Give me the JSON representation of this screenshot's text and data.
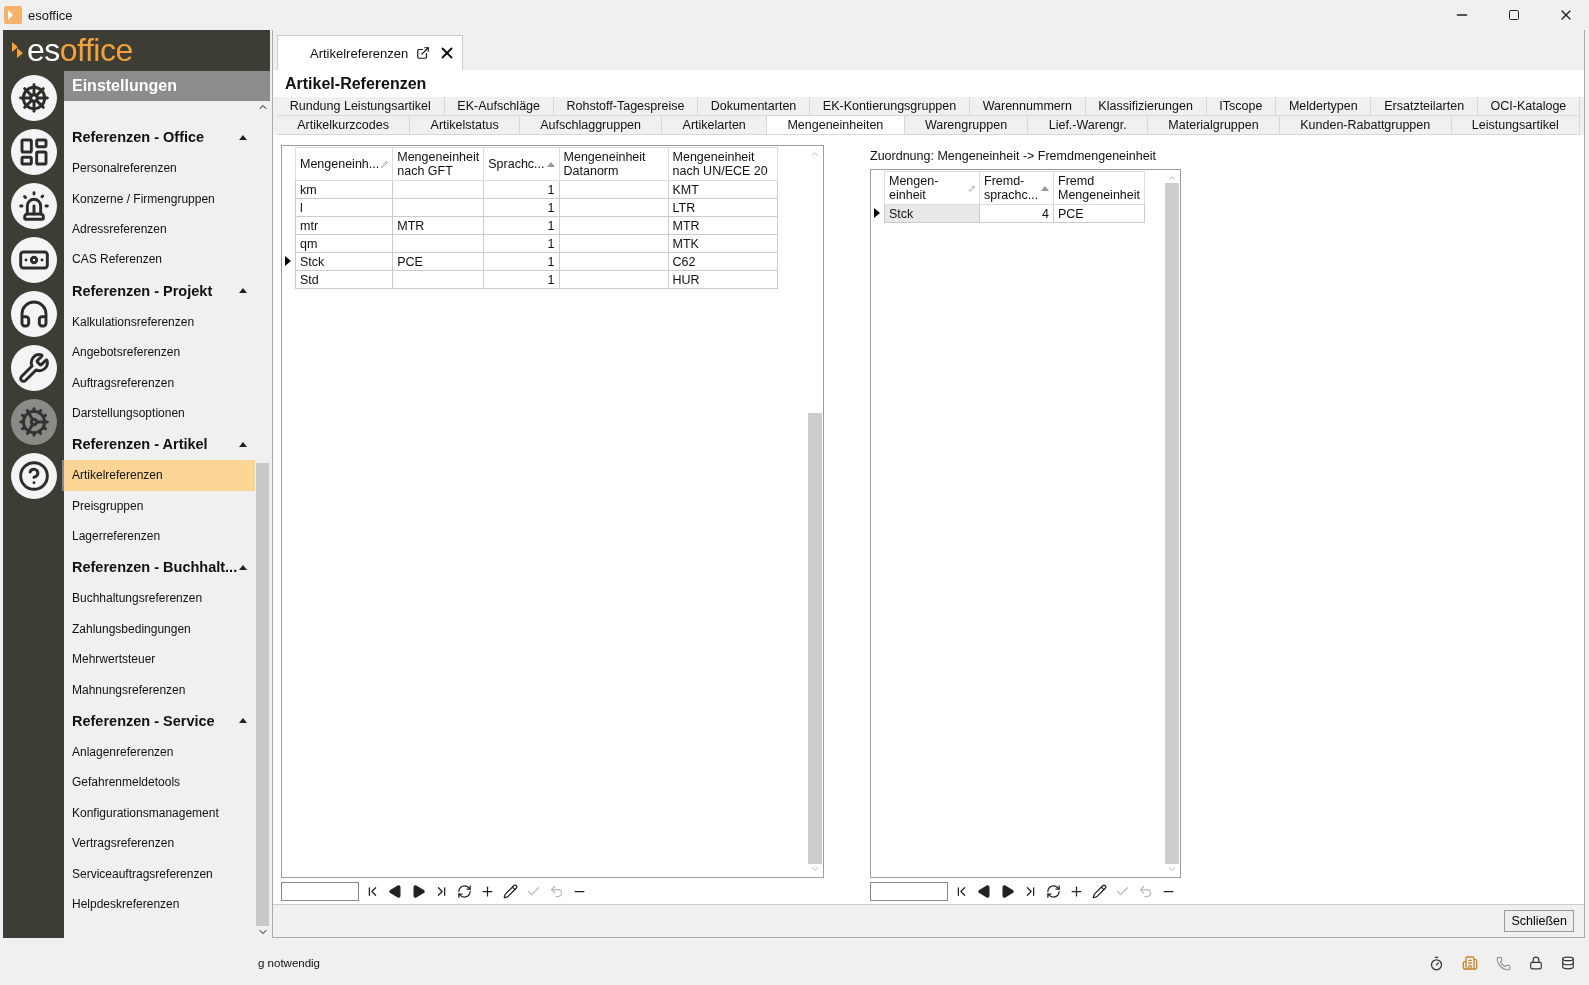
{
  "window": {
    "title": "esoffice"
  },
  "logo": {
    "prefix": "es",
    "suffix": "office"
  },
  "nav_icons": [
    {
      "kind": "wheel",
      "selected": false
    },
    {
      "kind": "board",
      "selected": false
    },
    {
      "kind": "siren",
      "selected": false
    },
    {
      "kind": "money",
      "selected": false
    },
    {
      "kind": "headset",
      "selected": false
    },
    {
      "kind": "tools",
      "selected": false
    },
    {
      "kind": "gears",
      "selected": true
    },
    {
      "kind": "help",
      "selected": false
    }
  ],
  "sidebar": {
    "header": "Einstellungen",
    "sections": [
      {
        "title": "Referenzen - Office",
        "expanded": true,
        "items": [
          {
            "label": "Personalreferenzen",
            "selected": false
          },
          {
            "label": "Konzerne / Firmengruppen",
            "selected": false
          },
          {
            "label": "Adressreferenzen",
            "selected": false
          },
          {
            "label": "CAS Referenzen",
            "selected": false
          }
        ]
      },
      {
        "title": "Referenzen - Projekt",
        "expanded": true,
        "items": [
          {
            "label": "Kalkulationsreferenzen",
            "selected": false
          },
          {
            "label": "Angebotsreferenzen",
            "selected": false
          },
          {
            "label": "Auftragsreferenzen",
            "selected": false
          },
          {
            "label": "Darstellungsoptionen",
            "selected": false
          }
        ]
      },
      {
        "title": "Referenzen - Artikel",
        "expanded": true,
        "items": [
          {
            "label": "Artikelreferenzen",
            "selected": true
          },
          {
            "label": "Preisgruppen",
            "selected": false
          },
          {
            "label": "Lagerreferenzen",
            "selected": false
          }
        ]
      },
      {
        "title": "Referenzen - Buchhalt...",
        "expanded": true,
        "items": [
          {
            "label": "Buchhaltungsreferenzen",
            "selected": false
          },
          {
            "label": "Zahlungsbedingungen",
            "selected": false
          },
          {
            "label": "Mehrwertsteuer",
            "selected": false
          },
          {
            "label": "Mahnungsreferenzen",
            "selected": false
          }
        ]
      },
      {
        "title": "Referenzen - Service",
        "expanded": true,
        "items": [
          {
            "label": "Anlagenreferenzen",
            "selected": false
          },
          {
            "label": "Gefahrenmeldetools",
            "selected": false
          },
          {
            "label": "Konfigurationsmanagement",
            "selected": false
          },
          {
            "label": "Vertragsreferenzen",
            "selected": false
          },
          {
            "label": "Serviceauftragsreferenzen",
            "selected": false
          },
          {
            "label": "Helpdeskreferenzen",
            "selected": false
          }
        ]
      }
    ]
  },
  "document_tab": {
    "label": "Artikelreferenzen"
  },
  "page_title": "Artikel-Referenzen",
  "tab_rows": [
    [
      {
        "label": "Rundung Leistungsartikel",
        "selected": false
      },
      {
        "label": "EK-Aufschläge",
        "selected": false
      },
      {
        "label": "Rohstoff-Tagespreise",
        "selected": false
      },
      {
        "label": "Dokumentarten",
        "selected": false
      },
      {
        "label": "EK-Kontierungsgruppen",
        "selected": false
      },
      {
        "label": "Warennummern",
        "selected": false
      },
      {
        "label": "Klassifizierungen",
        "selected": false
      },
      {
        "label": "ITscope",
        "selected": false
      },
      {
        "label": "Meldertypen",
        "selected": false
      },
      {
        "label": "Ersatzteilarten",
        "selected": false
      },
      {
        "label": "OCI-Kataloge",
        "selected": false
      }
    ],
    [
      {
        "label": "Artikelkurzcodes",
        "selected": false
      },
      {
        "label": "Artikelstatus",
        "selected": false
      },
      {
        "label": "Aufschlaggruppen",
        "selected": false
      },
      {
        "label": "Artikelarten",
        "selected": false
      },
      {
        "label": "Mengeneinheiten",
        "selected": true
      },
      {
        "label": "Warengruppen",
        "selected": false
      },
      {
        "label": "Lief.-Warengr.",
        "selected": false
      },
      {
        "label": "Materialgruppen",
        "selected": false
      },
      {
        "label": "Kunden-Rabattgruppen",
        "selected": false
      },
      {
        "label": "Leistungsartikel",
        "selected": false
      }
    ]
  ],
  "units_table": {
    "columns": [
      {
        "label": "Mengeneinh...",
        "edit_mark": true,
        "sorted": false
      },
      {
        "label": "Mengeneinheit nach GFT",
        "edit_mark": false,
        "sorted": false
      },
      {
        "label": "Sprachc...",
        "edit_mark": false,
        "sorted": true
      },
      {
        "label": "Mengeneinheit Datanorm",
        "edit_mark": false,
        "sorted": false
      },
      {
        "label": "Mengeneinheit nach UN/ECE 20",
        "edit_mark": false,
        "sorted": false
      }
    ],
    "rows": [
      {
        "cells": [
          "km",
          null,
          "1",
          null,
          "KMT"
        ],
        "current": false
      },
      {
        "cells": [
          "l",
          null,
          "1",
          null,
          "LTR"
        ],
        "current": false
      },
      {
        "cells": [
          "mtr",
          "MTR",
          "1",
          null,
          "MTR"
        ],
        "current": false
      },
      {
        "cells": [
          "qm",
          null,
          "1",
          null,
          "MTK"
        ],
        "current": false
      },
      {
        "cells": [
          "Stck",
          "PCE",
          "1",
          null,
          "C62"
        ],
        "current": true
      },
      {
        "cells": [
          "Std",
          null,
          "1",
          null,
          "HUR"
        ],
        "current": false
      }
    ]
  },
  "mapping": {
    "caption": "Zuordnung: Mengeneinheit -> Fremdmengeneinheit",
    "columns": [
      {
        "label": "Mengen-einheit",
        "edit_mark": true,
        "sorted": false
      },
      {
        "label": "Fremd-sprachc...",
        "edit_mark": false,
        "sorted": true
      },
      {
        "label": "Fremd Mengeneinheit",
        "edit_mark": false,
        "sorted": false
      }
    ],
    "rows": [
      {
        "cells": [
          "Stck",
          "4",
          "PCE"
        ],
        "current": true
      }
    ]
  },
  "close_button": "Schließen",
  "status_text": "g notwendig"
}
